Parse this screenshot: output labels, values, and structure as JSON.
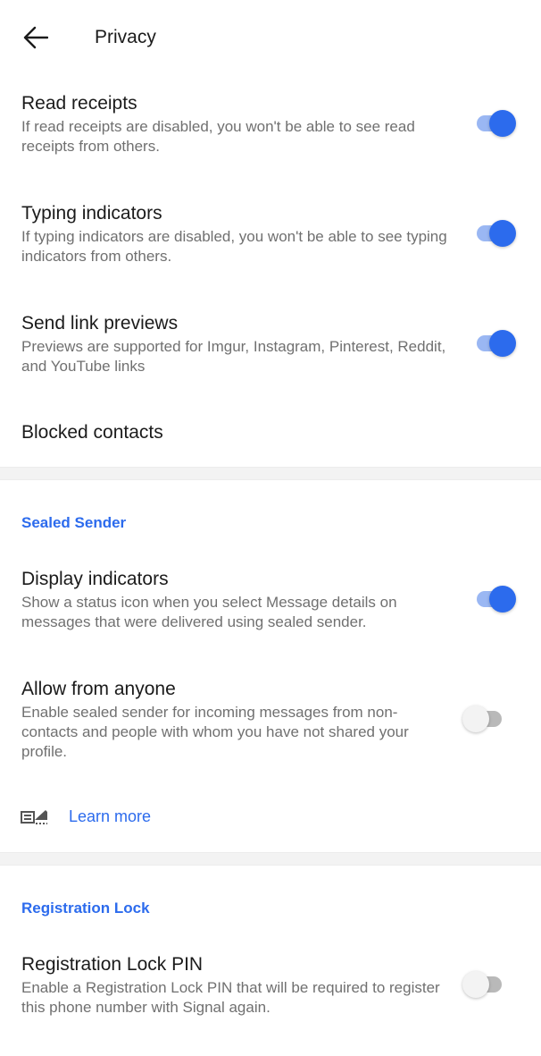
{
  "appbar": {
    "title": "Privacy",
    "back_icon": "arrow-left-icon"
  },
  "colors": {
    "accent": "#2c6bed",
    "switch_on_track": "#9ab7f3",
    "switch_off_thumb": "#f3f3f3",
    "summary_text": "#707070"
  },
  "prefs": {
    "read_receipts": {
      "title": "Read receipts",
      "summary": "If read receipts are disabled, you won't be able to see read receipts from others.",
      "enabled": true
    },
    "typing_indicators": {
      "title": "Typing indicators",
      "summary": "If typing indicators are disabled, you won't be able to see typing indicators from others.",
      "enabled": true
    },
    "link_previews": {
      "title": "Send link previews",
      "summary": "Previews are supported for Imgur, Instagram, Pinterest, Reddit, and YouTube links",
      "enabled": true
    },
    "blocked_contacts": {
      "title": "Blocked contacts"
    }
  },
  "sealed_sender": {
    "header": "Sealed Sender",
    "display_indicators": {
      "title": "Display indicators",
      "summary": "Show a status icon when you select Message details on messages that were delivered using sealed sender.",
      "enabled": true
    },
    "allow_from_anyone": {
      "title": "Allow from anyone",
      "summary": "Enable sealed sender for incoming messages from non-contacts and people with whom you have not shared your profile.",
      "enabled": false
    },
    "learn_more": {
      "label": "Learn more",
      "icon": "sealed-sender-icon"
    }
  },
  "registration_lock": {
    "header": "Registration Lock",
    "pin": {
      "title": "Registration Lock PIN",
      "summary": "Enable a Registration Lock PIN that will be required to register this phone number with Signal again.",
      "enabled": false
    }
  }
}
